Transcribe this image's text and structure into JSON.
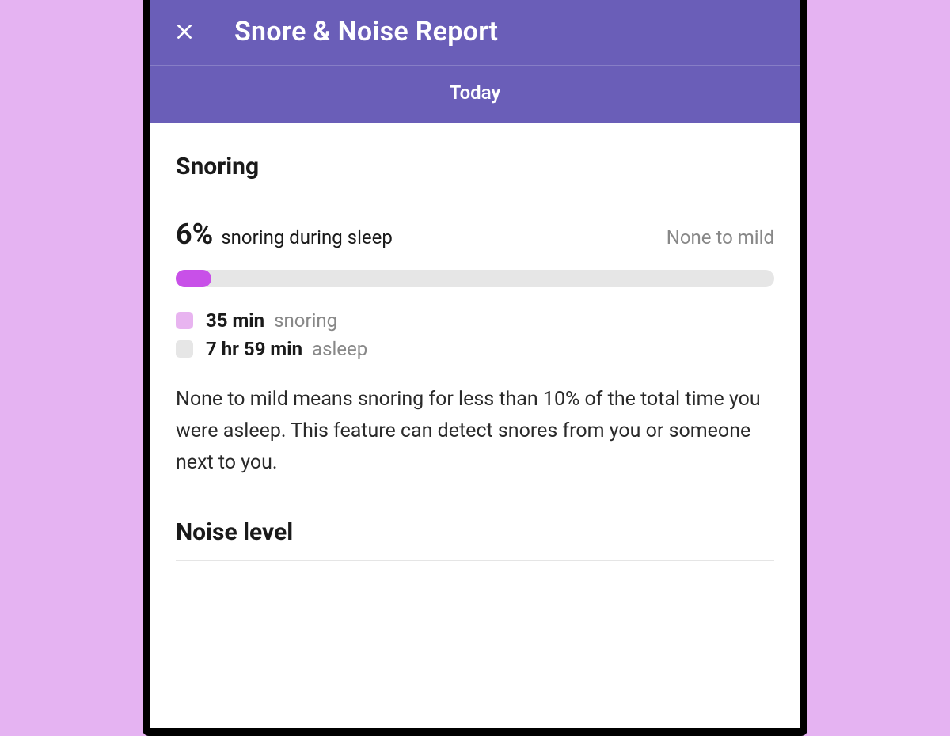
{
  "header": {
    "title": "Snore & Noise Report",
    "subtitle": "Today"
  },
  "snoring": {
    "section_title": "Snoring",
    "percent": "6%",
    "percent_label": "snoring during sleep",
    "severity": "None to mild",
    "progress_percent": 6,
    "legend": {
      "snoring_value": "35 min",
      "snoring_label": "snoring",
      "asleep_value": "7 hr 59 min",
      "asleep_label": "asleep"
    },
    "description": "None to mild means snoring for less than 10% of the total time you were asleep. This feature can detect snores from you or someone next to you."
  },
  "noise": {
    "section_title": "Noise level"
  },
  "colors": {
    "header_bg": "#6a5eb8",
    "progress_fill": "#c850e8",
    "swatch_snoring": "#e8b4f0",
    "swatch_asleep": "#e6e6e6"
  }
}
